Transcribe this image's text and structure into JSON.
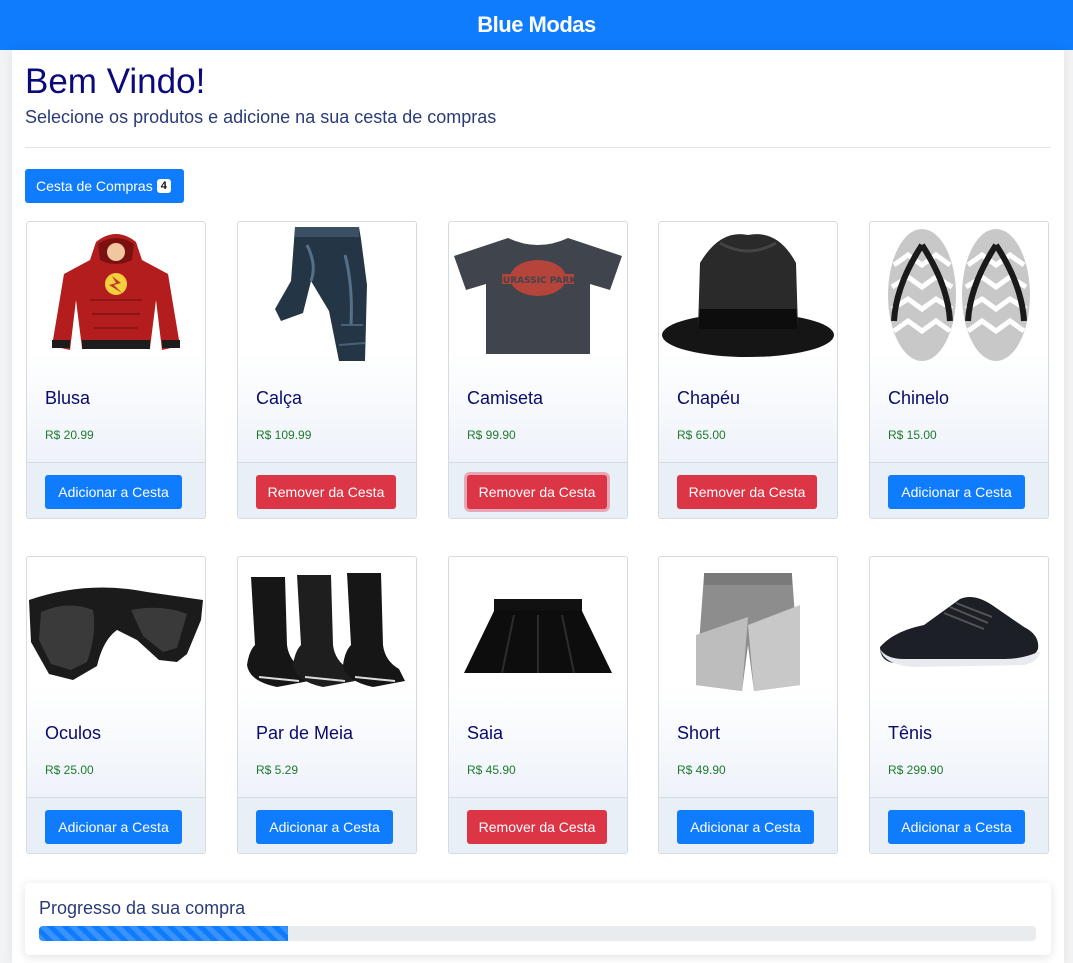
{
  "header": {
    "title": "Blue Modas"
  },
  "welcome": {
    "title": "Bem Vindo!",
    "subtitle": "Selecione os produtos e adicione na sua cesta de compras"
  },
  "cart": {
    "label": "Cesta de Compras",
    "count": "4"
  },
  "buttons": {
    "add": "Adicionar a Cesta",
    "remove": "Remover da Cesta"
  },
  "products": [
    {
      "name": "Blusa",
      "price": "R$ 20.99",
      "in_cart": false,
      "image": "hoodie-image"
    },
    {
      "name": "Calça",
      "price": "R$ 109.99",
      "in_cart": true,
      "image": "jeans-image"
    },
    {
      "name": "Camiseta",
      "price": "R$ 99.90",
      "in_cart": true,
      "image": "tshirt-image"
    },
    {
      "name": "Chapéu",
      "price": "R$ 65.00",
      "in_cart": true,
      "image": "hat-image"
    },
    {
      "name": "Chinelo",
      "price": "R$ 15.00",
      "in_cart": false,
      "image": "flipflops-image"
    },
    {
      "name": "Oculos",
      "price": "R$ 25.00",
      "in_cart": false,
      "image": "sunglasses-image"
    },
    {
      "name": "Par de Meia",
      "price": "R$ 5.29",
      "in_cart": false,
      "image": "socks-image"
    },
    {
      "name": "Saia",
      "price": "R$ 45.90",
      "in_cart": true,
      "image": "skirt-image"
    },
    {
      "name": "Short",
      "price": "R$ 49.90",
      "in_cart": false,
      "image": "shorts-image"
    },
    {
      "name": "Tênis",
      "price": "R$ 299.90",
      "in_cart": false,
      "image": "sneaker-image"
    }
  ],
  "progress": {
    "label": "Progresso da sua compra",
    "value_percent": 25
  },
  "colors": {
    "brand": "#0f7bfd",
    "danger": "#dc3545",
    "price": "#1f7a2e"
  }
}
